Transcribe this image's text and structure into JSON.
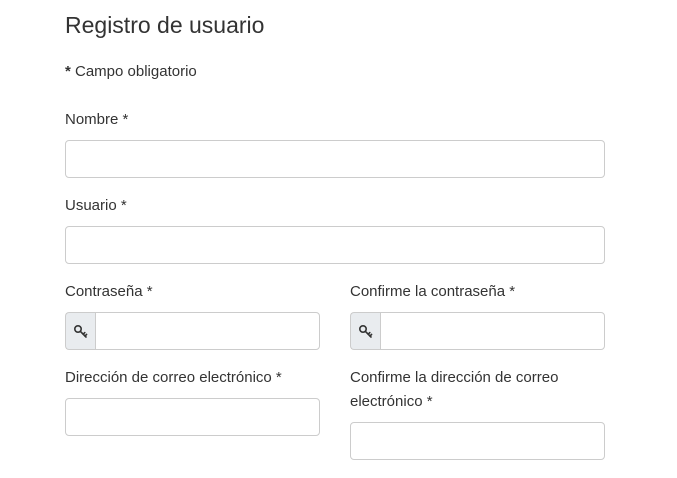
{
  "form": {
    "title": "Registro de usuario",
    "required_note": {
      "star": "*",
      "text": " Campo obligatorio"
    },
    "fields": {
      "nombre": {
        "label": "Nombre *",
        "value": "",
        "placeholder": ""
      },
      "usuario": {
        "label": "Usuario *",
        "value": "",
        "placeholder": ""
      },
      "password": {
        "label": "Contraseña *",
        "value": "",
        "placeholder": "",
        "icon": "key-icon"
      },
      "password_confirm": {
        "label": "Confirme la contraseña *",
        "value": "",
        "placeholder": "",
        "icon": "key-icon"
      },
      "email": {
        "label": "Dirección de correo electrónico *",
        "value": "",
        "placeholder": ""
      },
      "email_confirm": {
        "label": "Confirme la dirección de correo electrónico *",
        "value": "",
        "placeholder": ""
      }
    }
  },
  "colors": {
    "text": "#333333",
    "border": "#cccccc",
    "addon_bg": "#e9ecef"
  }
}
